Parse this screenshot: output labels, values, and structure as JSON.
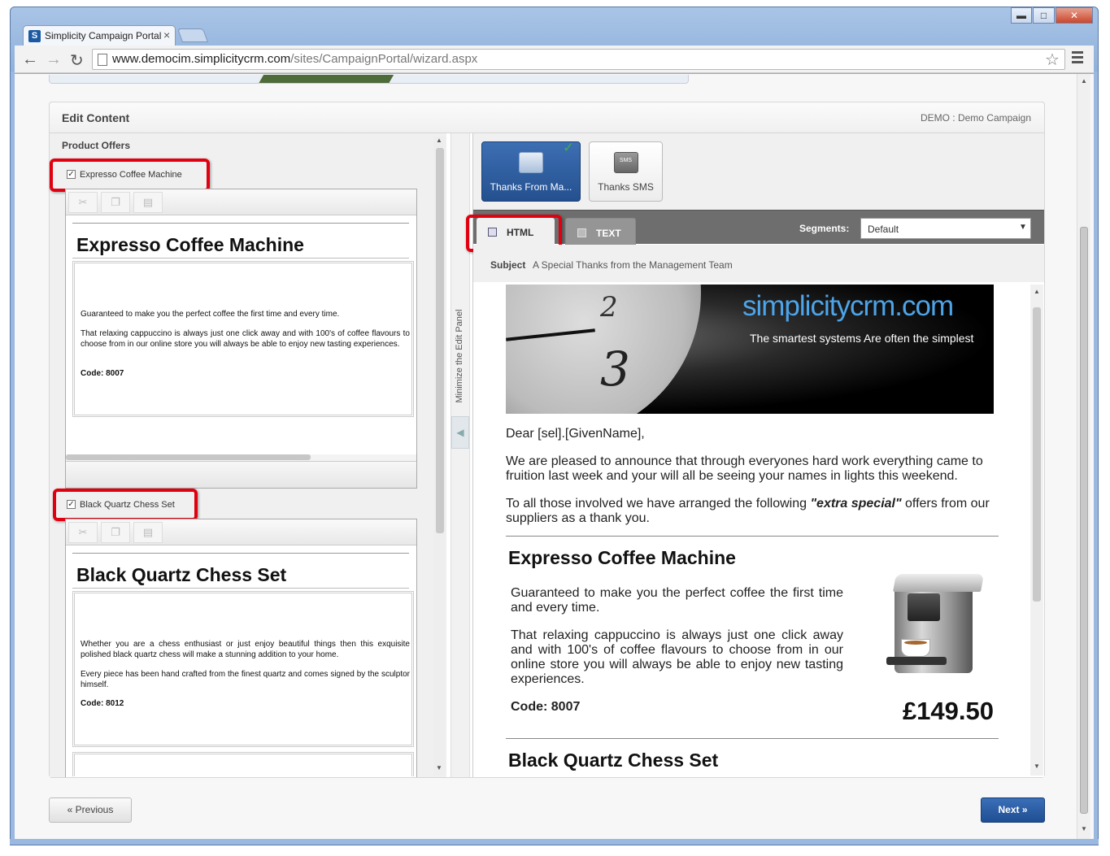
{
  "browser": {
    "tab_title": "Simplicity Campaign Portal",
    "tab_favicon": "S",
    "tab_close": "×",
    "url_host": "www.democim.simplicitycrm.com",
    "url_path": "/sites/CampaignPortal/wizard.aspx",
    "window_buttons": {
      "minimize": "▬",
      "maximize": "□",
      "close": "✕"
    }
  },
  "panel": {
    "title": "Edit Content",
    "campaign": "DEMO : Demo Campaign"
  },
  "left": {
    "section_title": "Product Offers",
    "products": [
      {
        "checkbox_label": "Expresso Coffee Machine",
        "checked": true,
        "heading": "Expresso Coffee Machine",
        "para1": "Guaranteed to make you the perfect coffee the first time and every time.",
        "para2": "That relaxing cappuccino is always just one click away and with 100's of coffee flavours to choose from in our online store you will always be able to enjoy new tasting experiences.",
        "code": "Code: 8007"
      },
      {
        "checkbox_label": "Black Quartz Chess Set",
        "checked": true,
        "heading": "Black Quartz Chess Set",
        "para1": "Whether you are a chess enthusiast or just enjoy beautiful things then this exquisite polished black quartz chess will make a stunning addition to your home.",
        "para2": "Every piece has been hand crafted from the finest quartz and comes signed by the sculptor himself.",
        "code": "Code: 8012"
      }
    ],
    "toolbar_icons": [
      "cut-icon",
      "copy-icon",
      "paste-icon"
    ]
  },
  "minimize_label": "Minimize the Edit Panel",
  "right": {
    "message_tabs": [
      {
        "label": "Thanks From Ma...",
        "icon": "envelope-icon",
        "selected": true
      },
      {
        "label": "Thanks SMS",
        "icon": "sms-icon",
        "icon_text": "SMS",
        "selected": false
      }
    ],
    "format_tabs": [
      {
        "label": "HTML",
        "selected": true
      },
      {
        "label": "TEXT",
        "selected": false
      }
    ],
    "segments_label": "Segments:",
    "segments_value": "Default",
    "subject_label": "Subject",
    "subject_value": "A Special Thanks from the Management Team"
  },
  "email": {
    "brand": "simplicitycrm.com",
    "tagline": "The smartest systems Are often the simplest",
    "clock_numerals": [
      "2",
      "3"
    ],
    "greeting": "Dear [sel].[GivenName],",
    "para1": "We are pleased to announce that through everyones hard work everything came to fruition last week and your will all be seeing your names in lights this weekend.",
    "para2_before": "To all those involved we have arranged the following ",
    "para2_emph": "\"extra special\"",
    "para2_after": " offers from our suppliers as a thank you.",
    "product1": {
      "heading": "Expresso Coffee Machine",
      "para1": "Guaranteed to make you the perfect coffee the first time and every time.",
      "para2": "That relaxing cappuccino is always just one click away and with 100's of coffee flavours to choose from in our online store you will always be able to enjoy new tasting experiences.",
      "code": "Code: 8007",
      "price": "£149.50"
    },
    "product2": {
      "heading": "Black Quartz Chess Set"
    }
  },
  "footer": {
    "previous": "« Previous",
    "next": "Next »"
  },
  "colors": {
    "highlight_red": "#e0000f",
    "selected_tab_blue": "#2f5fa3",
    "next_button_blue": "#245497",
    "brand_blue": "#4da4e8"
  }
}
